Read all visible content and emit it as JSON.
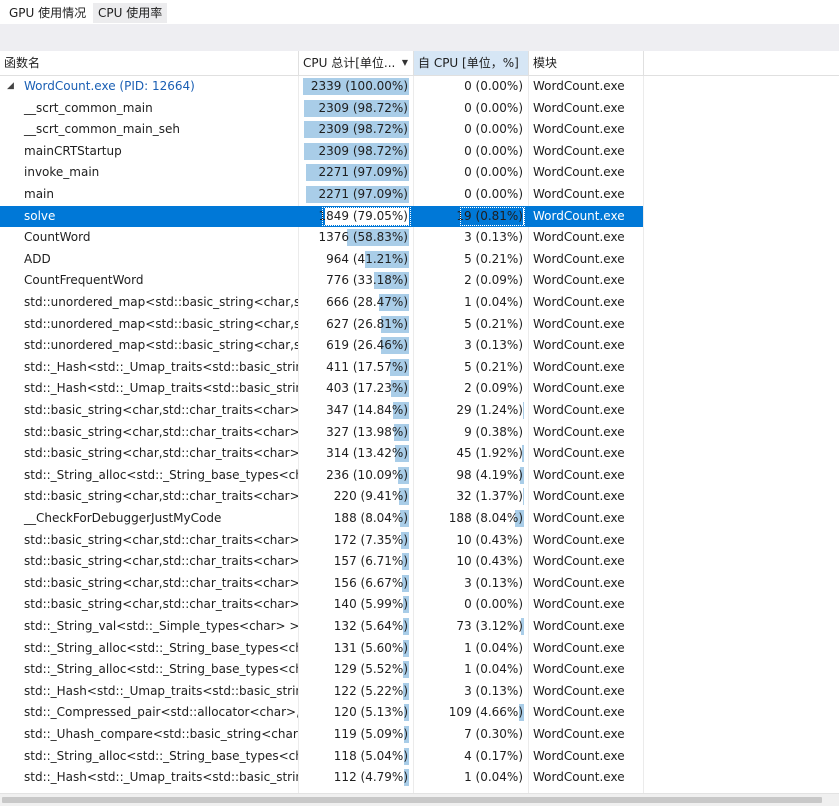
{
  "tabs": [
    {
      "label": "GPU 使用情况"
    },
    {
      "label": "CPU 使用率"
    }
  ],
  "columns": {
    "name": "函数名",
    "total": "CPU 总计[单位...",
    "self": "自 CPU [单位，%]",
    "module": "模块"
  },
  "rows": [
    {
      "name": "WordCount.exe (PID: 12664)",
      "total": "2339 (100.00%)",
      "total_pct": 100.0,
      "self": "0 (0.00%)",
      "self_pct": 0.0,
      "module": "WordCount.exe"
    },
    {
      "name": "__scrt_common_main",
      "total": "2309 (98.72%)",
      "total_pct": 98.72,
      "self": "0 (0.00%)",
      "self_pct": 0.0,
      "module": "WordCount.exe"
    },
    {
      "name": "__scrt_common_main_seh",
      "total": "2309 (98.72%)",
      "total_pct": 98.72,
      "self": "0 (0.00%)",
      "self_pct": 0.0,
      "module": "WordCount.exe"
    },
    {
      "name": "mainCRTStartup",
      "total": "2309 (98.72%)",
      "total_pct": 98.72,
      "self": "0 (0.00%)",
      "self_pct": 0.0,
      "module": "WordCount.exe"
    },
    {
      "name": "invoke_main",
      "total": "2271 (97.09%)",
      "total_pct": 97.09,
      "self": "0 (0.00%)",
      "self_pct": 0.0,
      "module": "WordCount.exe"
    },
    {
      "name": "main",
      "total": "2271 (97.09%)",
      "total_pct": 97.09,
      "self": "0 (0.00%)",
      "self_pct": 0.0,
      "module": "WordCount.exe"
    },
    {
      "name": "solve",
      "total": "1849 (79.05%)",
      "total_pct": 79.05,
      "self": "19 (0.81%)",
      "self_pct": 0.81,
      "module": "WordCount.exe"
    },
    {
      "name": "CountWord",
      "total": "1376 (58.83%)",
      "total_pct": 58.83,
      "self": "3 (0.13%)",
      "self_pct": 0.13,
      "module": "WordCount.exe"
    },
    {
      "name": "ADD",
      "total": "964 (41.21%)",
      "total_pct": 41.21,
      "self": "5 (0.21%)",
      "self_pct": 0.21,
      "module": "WordCount.exe"
    },
    {
      "name": "CountFrequentWord",
      "total": "776 (33.18%)",
      "total_pct": 33.18,
      "self": "2 (0.09%)",
      "self_pct": 0.09,
      "module": "WordCount.exe"
    },
    {
      "name": "std::unordered_map<std::basic_string<char,s...",
      "total": "666 (28.47%)",
      "total_pct": 28.47,
      "self": "1 (0.04%)",
      "self_pct": 0.04,
      "module": "WordCount.exe"
    },
    {
      "name": "std::unordered_map<std::basic_string<char,s...",
      "total": "627 (26.81%)",
      "total_pct": 26.81,
      "self": "5 (0.21%)",
      "self_pct": 0.21,
      "module": "WordCount.exe"
    },
    {
      "name": "std::unordered_map<std::basic_string<char,s...",
      "total": "619 (26.46%)",
      "total_pct": 26.46,
      "self": "3 (0.13%)",
      "self_pct": 0.13,
      "module": "WordCount.exe"
    },
    {
      "name": "std::_Hash<std::_Umap_traits<std::basic_strin...",
      "total": "411 (17.57%)",
      "total_pct": 17.57,
      "self": "5 (0.21%)",
      "self_pct": 0.21,
      "module": "WordCount.exe"
    },
    {
      "name": "std::_Hash<std::_Umap_traits<std::basic_strin...",
      "total": "403 (17.23%)",
      "total_pct": 17.23,
      "self": "2 (0.09%)",
      "self_pct": 0.09,
      "module": "WordCount.exe"
    },
    {
      "name": "std::basic_string<char,std::char_traits<char>,s...",
      "total": "347 (14.84%)",
      "total_pct": 14.84,
      "self": "29 (1.24%)",
      "self_pct": 1.24,
      "module": "WordCount.exe"
    },
    {
      "name": "std::basic_string<char,std::char_traits<char>,s...",
      "total": "327 (13.98%)",
      "total_pct": 13.98,
      "self": "9 (0.38%)",
      "self_pct": 0.38,
      "module": "WordCount.exe"
    },
    {
      "name": "std::basic_string<char,std::char_traits<char>,s...",
      "total": "314 (13.42%)",
      "total_pct": 13.42,
      "self": "45 (1.92%)",
      "self_pct": 1.92,
      "module": "WordCount.exe"
    },
    {
      "name": "std::_String_alloc<std::_String_base_types<ch...",
      "total": "236 (10.09%)",
      "total_pct": 10.09,
      "self": "98 (4.19%)",
      "self_pct": 4.19,
      "module": "WordCount.exe"
    },
    {
      "name": "std::basic_string<char,std::char_traits<char>,s...",
      "total": "220 (9.41%)",
      "total_pct": 9.41,
      "self": "32 (1.37%)",
      "self_pct": 1.37,
      "module": "WordCount.exe"
    },
    {
      "name": "__CheckForDebuggerJustMyCode",
      "total": "188 (8.04%)",
      "total_pct": 8.04,
      "self": "188 (8.04%)",
      "self_pct": 8.04,
      "module": "WordCount.exe"
    },
    {
      "name": "std::basic_string<char,std::char_traits<char>,s...",
      "total": "172 (7.35%)",
      "total_pct": 7.35,
      "self": "10 (0.43%)",
      "self_pct": 0.43,
      "module": "WordCount.exe"
    },
    {
      "name": "std::basic_string<char,std::char_traits<char>,s...",
      "total": "157 (6.71%)",
      "total_pct": 6.71,
      "self": "10 (0.43%)",
      "self_pct": 0.43,
      "module": "WordCount.exe"
    },
    {
      "name": "std::basic_string<char,std::char_traits<char>,s...",
      "total": "156 (6.67%)",
      "total_pct": 6.67,
      "self": "3 (0.13%)",
      "self_pct": 0.13,
      "module": "WordCount.exe"
    },
    {
      "name": "std::basic_string<char,std::char_traits<char>,s...",
      "total": "140 (5.99%)",
      "total_pct": 5.99,
      "self": "0 (0.00%)",
      "self_pct": 0.0,
      "module": "WordCount.exe"
    },
    {
      "name": "std::_String_val<std::_Simple_types<char> >::...",
      "total": "132 (5.64%)",
      "total_pct": 5.64,
      "self": "73 (3.12%)",
      "self_pct": 3.12,
      "module": "WordCount.exe"
    },
    {
      "name": "std::_String_alloc<std::_String_base_types<ch...",
      "total": "131 (5.60%)",
      "total_pct": 5.6,
      "self": "1 (0.04%)",
      "self_pct": 0.04,
      "module": "WordCount.exe"
    },
    {
      "name": "std::_String_alloc<std::_String_base_types<ch...",
      "total": "129 (5.52%)",
      "total_pct": 5.52,
      "self": "1 (0.04%)",
      "self_pct": 0.04,
      "module": "WordCount.exe"
    },
    {
      "name": "std::_Hash<std::_Umap_traits<std::basic_strin...",
      "total": "122 (5.22%)",
      "total_pct": 5.22,
      "self": "3 (0.13%)",
      "self_pct": 0.13,
      "module": "WordCount.exe"
    },
    {
      "name": "std::_Compressed_pair<std::allocator<char>,...",
      "total": "120 (5.13%)",
      "total_pct": 5.13,
      "self": "109 (4.66%)",
      "self_pct": 4.66,
      "module": "WordCount.exe"
    },
    {
      "name": "std::_Uhash_compare<std::basic_string<char,...",
      "total": "119 (5.09%)",
      "total_pct": 5.09,
      "self": "7 (0.30%)",
      "self_pct": 0.3,
      "module": "WordCount.exe"
    },
    {
      "name": "std::_String_alloc<std::_String_base_types<ch...",
      "total": "118 (5.04%)",
      "total_pct": 5.04,
      "self": "4 (0.17%)",
      "self_pct": 0.17,
      "module": "WordCount.exe"
    },
    {
      "name": "std::_Hash<std::_Umap_traits<std::basic_strin...",
      "total": "112 (4.79%)",
      "total_pct": 4.79,
      "self": "1 (0.04%)",
      "self_pct": 0.04,
      "module": "WordCount.exe"
    }
  ],
  "selected_row": "solve",
  "colors": {
    "selection": "#0078d7",
    "bar": "#a9cde8",
    "link": "#1a5fb4",
    "sorted_header": "#d6e6f5"
  }
}
